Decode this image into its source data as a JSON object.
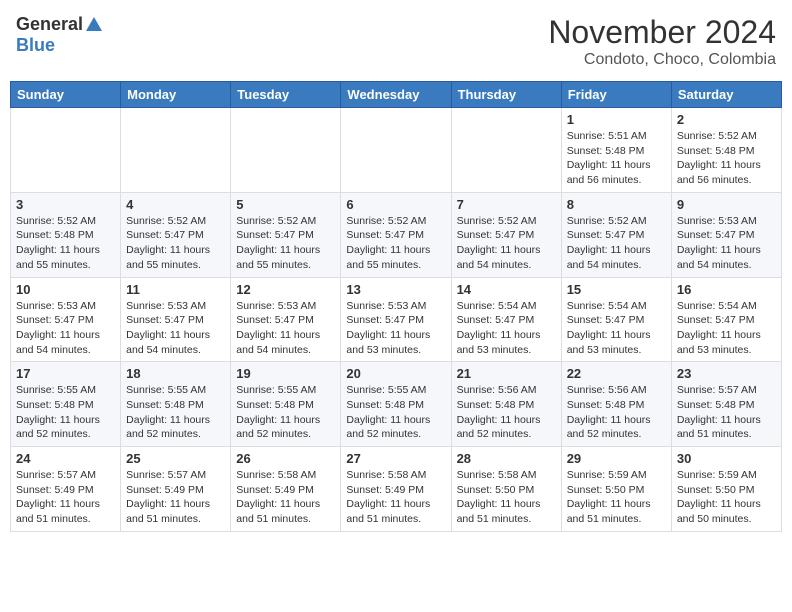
{
  "header": {
    "logo_general": "General",
    "logo_blue": "Blue",
    "title": "November 2024",
    "location": "Condoto, Choco, Colombia"
  },
  "days_of_week": [
    "Sunday",
    "Monday",
    "Tuesday",
    "Wednesday",
    "Thursday",
    "Friday",
    "Saturday"
  ],
  "weeks": [
    {
      "days": [
        {
          "number": "",
          "info": ""
        },
        {
          "number": "",
          "info": ""
        },
        {
          "number": "",
          "info": ""
        },
        {
          "number": "",
          "info": ""
        },
        {
          "number": "",
          "info": ""
        },
        {
          "number": "1",
          "info": "Sunrise: 5:51 AM\nSunset: 5:48 PM\nDaylight: 11 hours\nand 56 minutes."
        },
        {
          "number": "2",
          "info": "Sunrise: 5:52 AM\nSunset: 5:48 PM\nDaylight: 11 hours\nand 56 minutes."
        }
      ]
    },
    {
      "days": [
        {
          "number": "3",
          "info": "Sunrise: 5:52 AM\nSunset: 5:48 PM\nDaylight: 11 hours\nand 55 minutes."
        },
        {
          "number": "4",
          "info": "Sunrise: 5:52 AM\nSunset: 5:47 PM\nDaylight: 11 hours\nand 55 minutes."
        },
        {
          "number": "5",
          "info": "Sunrise: 5:52 AM\nSunset: 5:47 PM\nDaylight: 11 hours\nand 55 minutes."
        },
        {
          "number": "6",
          "info": "Sunrise: 5:52 AM\nSunset: 5:47 PM\nDaylight: 11 hours\nand 55 minutes."
        },
        {
          "number": "7",
          "info": "Sunrise: 5:52 AM\nSunset: 5:47 PM\nDaylight: 11 hours\nand 54 minutes."
        },
        {
          "number": "8",
          "info": "Sunrise: 5:52 AM\nSunset: 5:47 PM\nDaylight: 11 hours\nand 54 minutes."
        },
        {
          "number": "9",
          "info": "Sunrise: 5:53 AM\nSunset: 5:47 PM\nDaylight: 11 hours\nand 54 minutes."
        }
      ]
    },
    {
      "days": [
        {
          "number": "10",
          "info": "Sunrise: 5:53 AM\nSunset: 5:47 PM\nDaylight: 11 hours\nand 54 minutes."
        },
        {
          "number": "11",
          "info": "Sunrise: 5:53 AM\nSunset: 5:47 PM\nDaylight: 11 hours\nand 54 minutes."
        },
        {
          "number": "12",
          "info": "Sunrise: 5:53 AM\nSunset: 5:47 PM\nDaylight: 11 hours\nand 54 minutes."
        },
        {
          "number": "13",
          "info": "Sunrise: 5:53 AM\nSunset: 5:47 PM\nDaylight: 11 hours\nand 53 minutes."
        },
        {
          "number": "14",
          "info": "Sunrise: 5:54 AM\nSunset: 5:47 PM\nDaylight: 11 hours\nand 53 minutes."
        },
        {
          "number": "15",
          "info": "Sunrise: 5:54 AM\nSunset: 5:47 PM\nDaylight: 11 hours\nand 53 minutes."
        },
        {
          "number": "16",
          "info": "Sunrise: 5:54 AM\nSunset: 5:47 PM\nDaylight: 11 hours\nand 53 minutes."
        }
      ]
    },
    {
      "days": [
        {
          "number": "17",
          "info": "Sunrise: 5:55 AM\nSunset: 5:48 PM\nDaylight: 11 hours\nand 52 minutes."
        },
        {
          "number": "18",
          "info": "Sunrise: 5:55 AM\nSunset: 5:48 PM\nDaylight: 11 hours\nand 52 minutes."
        },
        {
          "number": "19",
          "info": "Sunrise: 5:55 AM\nSunset: 5:48 PM\nDaylight: 11 hours\nand 52 minutes."
        },
        {
          "number": "20",
          "info": "Sunrise: 5:55 AM\nSunset: 5:48 PM\nDaylight: 11 hours\nand 52 minutes."
        },
        {
          "number": "21",
          "info": "Sunrise: 5:56 AM\nSunset: 5:48 PM\nDaylight: 11 hours\nand 52 minutes."
        },
        {
          "number": "22",
          "info": "Sunrise: 5:56 AM\nSunset: 5:48 PM\nDaylight: 11 hours\nand 52 minutes."
        },
        {
          "number": "23",
          "info": "Sunrise: 5:57 AM\nSunset: 5:48 PM\nDaylight: 11 hours\nand 51 minutes."
        }
      ]
    },
    {
      "days": [
        {
          "number": "24",
          "info": "Sunrise: 5:57 AM\nSunset: 5:49 PM\nDaylight: 11 hours\nand 51 minutes."
        },
        {
          "number": "25",
          "info": "Sunrise: 5:57 AM\nSunset: 5:49 PM\nDaylight: 11 hours\nand 51 minutes."
        },
        {
          "number": "26",
          "info": "Sunrise: 5:58 AM\nSunset: 5:49 PM\nDaylight: 11 hours\nand 51 minutes."
        },
        {
          "number": "27",
          "info": "Sunrise: 5:58 AM\nSunset: 5:49 PM\nDaylight: 11 hours\nand 51 minutes."
        },
        {
          "number": "28",
          "info": "Sunrise: 5:58 AM\nSunset: 5:50 PM\nDaylight: 11 hours\nand 51 minutes."
        },
        {
          "number": "29",
          "info": "Sunrise: 5:59 AM\nSunset: 5:50 PM\nDaylight: 11 hours\nand 51 minutes."
        },
        {
          "number": "30",
          "info": "Sunrise: 5:59 AM\nSunset: 5:50 PM\nDaylight: 11 hours\nand 50 minutes."
        }
      ]
    }
  ]
}
